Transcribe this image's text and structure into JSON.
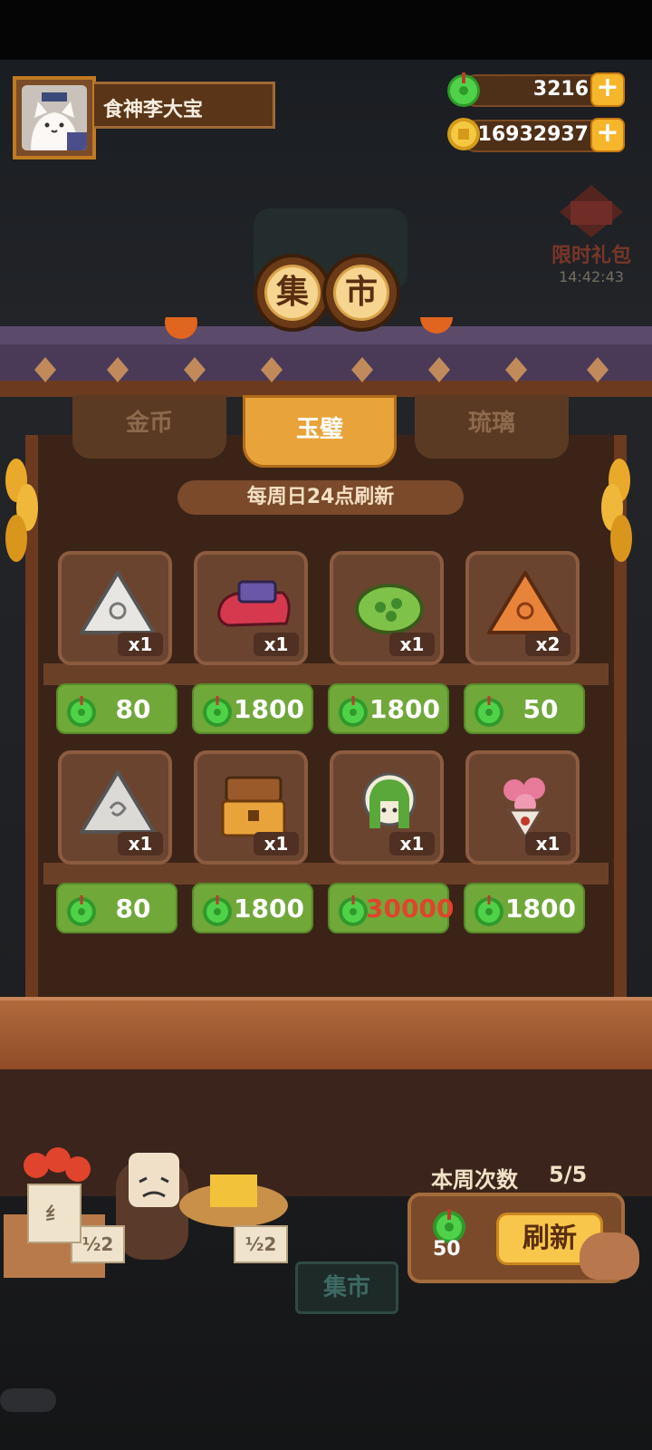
{
  "player": {
    "name": "食神李大宝"
  },
  "currency": {
    "jade": "3216",
    "gold": "16932937"
  },
  "event": {
    "title": "限时礼包",
    "timer": "14:42:43"
  },
  "market": {
    "title_chars": [
      "集",
      "市"
    ]
  },
  "tabs": [
    "金币",
    "玉璧",
    "琉璃"
  ],
  "active_tab": "玉璧",
  "refresh_note": "每周日24点刷新",
  "items": [
    {
      "icon": "white-rice-cake-icon",
      "qty": "x1",
      "price": "80"
    },
    {
      "icon": "red-shoe-icon",
      "qty": "x1",
      "price": "1800"
    },
    {
      "icon": "green-bun-icon",
      "qty": "x1",
      "price": "1800"
    },
    {
      "icon": "orange-rice-cake-icon",
      "qty": "x2",
      "price": "50"
    },
    {
      "icon": "swirl-rice-cake-icon",
      "qty": "x1",
      "price": "80"
    },
    {
      "icon": "treasure-chest-icon",
      "qty": "x1",
      "price": "1800"
    },
    {
      "icon": "green-hair-character-icon",
      "qty": "x1",
      "price": "30000"
    },
    {
      "icon": "flower-bouquet-icon",
      "qty": "x1",
      "price": "1800"
    }
  ],
  "weekly": {
    "label": "本周次数",
    "value": "5/5",
    "cost": "50",
    "button": "刷新"
  },
  "bottom": {
    "market_sign": "集市",
    "tag_left": "½2",
    "tag_right": "½2",
    "tag_left_top": "纟"
  },
  "colors": {
    "jade_green": "#3fbf3a",
    "price_bg": "#70a83a",
    "tab_active": "#e8a43b",
    "unaffordable": "#e0442c"
  }
}
